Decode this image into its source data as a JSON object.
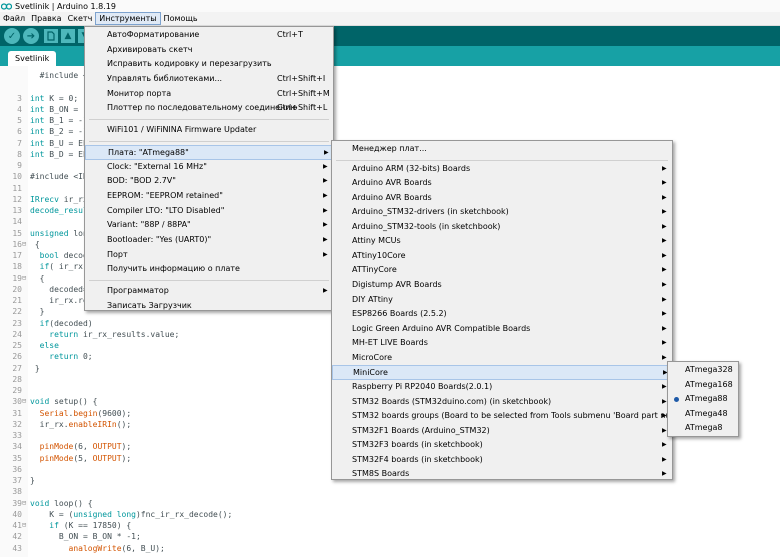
{
  "window": {
    "title": "Svetlinik | Arduino 1.8.19"
  },
  "menubar": {
    "items": [
      "Файл",
      "Правка",
      "Скетч",
      "Инструменты",
      "Помощь"
    ],
    "active_index": 3
  },
  "toolbar": {
    "verify_icon": "check-icon",
    "upload_icon": "arrow-right-icon",
    "new_icon": "new-file-icon",
    "open_icon": "open-arrow-up-icon",
    "save_icon": "save-arrow-down-icon"
  },
  "tab": {
    "label": "Svetlinik"
  },
  "colors": {
    "toolbar_bg": "#006468",
    "tabstrip_bg": "#17a1a5",
    "keyword": "#00979c",
    "function": "#d35400",
    "menu_bg": "#f0f0f0",
    "highlight_bg": "#dbe8f7",
    "radio": "#1e5aa8"
  },
  "code": [
    {
      "ln": "",
      "fold": "",
      "text": "  #include <"
    },
    {
      "ln": "",
      "fold": "",
      "text": ""
    },
    {
      "ln": "3",
      "fold": "",
      "text": "int K = 0;"
    },
    {
      "ln": "4",
      "fold": "",
      "text": "int B_ON = -"
    },
    {
      "ln": "5",
      "fold": "",
      "text": "int B_1 = -1"
    },
    {
      "ln": "6",
      "fold": "",
      "text": "int B_2 = -1"
    },
    {
      "ln": "7",
      "fold": "",
      "text": "int B_U = EE"
    },
    {
      "ln": "8",
      "fold": "",
      "text": "int B_D = EE"
    },
    {
      "ln": "9",
      "fold": "",
      "text": ""
    },
    {
      "ln": "10",
      "fold": "",
      "text": "#include <IR"
    },
    {
      "ln": "11",
      "fold": "",
      "text": ""
    },
    {
      "ln": "12",
      "fold": "",
      "text": "IRrecv ir_rx"
    },
    {
      "ln": "13",
      "fold": "",
      "text": "decode_resul"
    },
    {
      "ln": "14",
      "fold": "",
      "text": ""
    },
    {
      "ln": "15",
      "fold": "",
      "text": "unsigned lon"
    },
    {
      "ln": "16",
      "fold": "⊟",
      "text": " {"
    },
    {
      "ln": "17",
      "fold": "",
      "text": "  bool decod"
    },
    {
      "ln": "18",
      "fold": "",
      "text": "  if( ir_rx."
    },
    {
      "ln": "19",
      "fold": "⊟",
      "text": "  {"
    },
    {
      "ln": "20",
      "fold": "",
      "text": "    decoded="
    },
    {
      "ln": "21",
      "fold": "",
      "text": "    ir_rx.re"
    },
    {
      "ln": "22",
      "fold": "",
      "text": "  }"
    },
    {
      "ln": "23",
      "fold": "",
      "text": "  if(decoded)"
    },
    {
      "ln": "24",
      "fold": "",
      "text": "    return ir_rx_results.value;"
    },
    {
      "ln": "25",
      "fold": "",
      "text": "  else"
    },
    {
      "ln": "26",
      "fold": "",
      "text": "    return 0;"
    },
    {
      "ln": "27",
      "fold": "",
      "text": " }"
    },
    {
      "ln": "28",
      "fold": "",
      "text": ""
    },
    {
      "ln": "29",
      "fold": "",
      "text": ""
    },
    {
      "ln": "30",
      "fold": "⊟",
      "text": "void setup() {"
    },
    {
      "ln": "31",
      "fold": "",
      "text": "  Serial.begin(9600);"
    },
    {
      "ln": "32",
      "fold": "",
      "text": "  ir_rx.enableIRIn();"
    },
    {
      "ln": "33",
      "fold": "",
      "text": ""
    },
    {
      "ln": "34",
      "fold": "",
      "text": "  pinMode(6, OUTPUT);"
    },
    {
      "ln": "35",
      "fold": "",
      "text": "  pinMode(5, OUTPUT);"
    },
    {
      "ln": "36",
      "fold": "",
      "text": ""
    },
    {
      "ln": "37",
      "fold": "",
      "text": "}"
    },
    {
      "ln": "38",
      "fold": "",
      "text": ""
    },
    {
      "ln": "39",
      "fold": "⊟",
      "text": "void loop() {"
    },
    {
      "ln": "40",
      "fold": "",
      "text": "    K = (unsigned long)fnc_ir_rx_decode();"
    },
    {
      "ln": "41",
      "fold": "⊟",
      "text": "    if (K == 17850) {"
    },
    {
      "ln": "42",
      "fold": "",
      "text": "      B_ON = B_ON * -1;"
    },
    {
      "ln": "43",
      "fold": "",
      "text": "        analogWrite(6, B_U);"
    }
  ],
  "tools_menu": {
    "items": [
      {
        "label": "АвтоФорматирование",
        "shortcut": "Ctrl+T",
        "arrow": false
      },
      {
        "label": "Архивировать скетч",
        "shortcut": "",
        "arrow": false
      },
      {
        "label": "Исправить кодировку и перезагрузить",
        "shortcut": "",
        "arrow": false
      },
      {
        "label": "Управлять библиотеками...",
        "shortcut": "Ctrl+Shift+I",
        "arrow": false
      },
      {
        "label": "Монитор порта",
        "shortcut": "Ctrl+Shift+M",
        "arrow": false
      },
      {
        "label": "Плоттер по последовательному соединению",
        "shortcut": "Ctrl+Shift+L",
        "arrow": false
      },
      {
        "sep": true
      },
      {
        "label": "WiFi101 / WiFiNINA Firmware Updater",
        "shortcut": "",
        "arrow": false
      },
      {
        "sep": true
      },
      {
        "label": "Плата: \"ATmega88\"",
        "shortcut": "",
        "arrow": true,
        "highlight": true
      },
      {
        "label": "Clock: \"External 16 MHz\"",
        "shortcut": "",
        "arrow": true
      },
      {
        "label": "BOD: \"BOD 2.7V\"",
        "shortcut": "",
        "arrow": true
      },
      {
        "label": "EEPROM: \"EEPROM retained\"",
        "shortcut": "",
        "arrow": true
      },
      {
        "label": "Compiler LTO: \"LTO Disabled\"",
        "shortcut": "",
        "arrow": true
      },
      {
        "label": "Variant: \"88P / 88PA\"",
        "shortcut": "",
        "arrow": true
      },
      {
        "label": "Bootloader: \"Yes (UART0)\"",
        "shortcut": "",
        "arrow": true
      },
      {
        "label": "Порт",
        "shortcut": "",
        "arrow": true
      },
      {
        "label": "Получить информацию о плате",
        "shortcut": "",
        "arrow": false
      },
      {
        "sep": true
      },
      {
        "label": "Программатор",
        "shortcut": "",
        "arrow": true
      },
      {
        "label": "Записать Загрузчик",
        "shortcut": "",
        "arrow": false
      }
    ]
  },
  "board_menu": {
    "items": [
      {
        "label": "Менеджер плат...",
        "arrow": false
      },
      {
        "sep": true
      },
      {
        "label": "Arduino ARM (32-bits) Boards",
        "arrow": true
      },
      {
        "label": "Arduino AVR Boards",
        "arrow": true
      },
      {
        "label": "Arduino AVR Boards",
        "arrow": true
      },
      {
        "label": "Arduino_STM32-drivers (in sketchbook)",
        "arrow": true
      },
      {
        "label": "Arduino_STM32-tools (in sketchbook)",
        "arrow": true
      },
      {
        "label": "Attiny MCUs",
        "arrow": true
      },
      {
        "label": "ATtiny10Core",
        "arrow": true
      },
      {
        "label": "ATTinyCore",
        "arrow": true
      },
      {
        "label": "Digistump AVR Boards",
        "arrow": true
      },
      {
        "label": "DIY ATtiny",
        "arrow": true
      },
      {
        "label": "ESP8266 Boards (2.5.2)",
        "arrow": true
      },
      {
        "label": "Logic Green Arduino AVR Compatible Boards",
        "arrow": true
      },
      {
        "label": "MH-ET LIVE Boards",
        "arrow": true
      },
      {
        "label": "MicroCore",
        "arrow": true
      },
      {
        "label": "MiniCore",
        "arrow": true,
        "highlight": true
      },
      {
        "label": "Raspberry Pi RP2040 Boards(2.0.1)",
        "arrow": true
      },
      {
        "label": "STM32 Boards (STM32duino.com) (in sketchbook)",
        "arrow": true
      },
      {
        "label": "STM32 boards groups (Board to be selected from Tools submenu 'Board part number')",
        "arrow": true
      },
      {
        "label": "STM32F1 Boards (Arduino_STM32)",
        "arrow": true
      },
      {
        "label": "STM32F3 boards (in sketchbook)",
        "arrow": true
      },
      {
        "label": "STM32F4 boards (in sketchbook)",
        "arrow": true
      },
      {
        "label": "STM8S Boards",
        "arrow": true
      }
    ]
  },
  "minicore_menu": {
    "items": [
      {
        "label": "ATmega328",
        "selected": false
      },
      {
        "label": "ATmega168",
        "selected": false
      },
      {
        "label": "ATmega88",
        "selected": true
      },
      {
        "label": "ATmega48",
        "selected": false
      },
      {
        "label": "ATmega8",
        "selected": false
      }
    ]
  }
}
